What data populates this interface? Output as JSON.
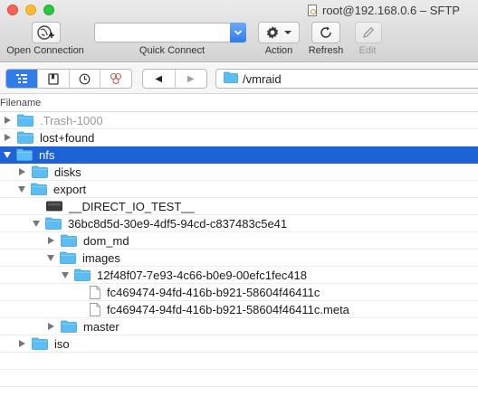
{
  "window": {
    "title": "root@192.168.0.6 – SFTP"
  },
  "toolbar": {
    "open_connection": "Open Connection",
    "quick_connect": "Quick Connect",
    "quick_connect_value": "",
    "action": "Action",
    "refresh": "Refresh",
    "edit": "Edit"
  },
  "nav": {
    "back": "◀",
    "forward": "▶",
    "path": "/vmraid"
  },
  "column": {
    "filename": "Filename"
  },
  "accent_color": "#1e63d6",
  "tree": [
    {
      "label": ".Trash-1000",
      "depth": 0,
      "kind": "folder",
      "disclosure": "collapsed",
      "dimmed": true
    },
    {
      "label": "lost+found",
      "depth": 0,
      "kind": "folder",
      "disclosure": "collapsed"
    },
    {
      "label": "nfs",
      "depth": 0,
      "kind": "folder",
      "disclosure": "expanded",
      "selected": true
    },
    {
      "label": "disks",
      "depth": 1,
      "kind": "folder",
      "disclosure": "collapsed"
    },
    {
      "label": "export",
      "depth": 1,
      "kind": "folder",
      "disclosure": "expanded"
    },
    {
      "label": "__DIRECT_IO_TEST__",
      "depth": 2,
      "kind": "device",
      "disclosure": "none"
    },
    {
      "label": "36bc8d5d-30e9-4df5-94cd-c837483c5e41",
      "depth": 2,
      "kind": "folder",
      "disclosure": "expanded"
    },
    {
      "label": "dom_md",
      "depth": 3,
      "kind": "folder",
      "disclosure": "collapsed"
    },
    {
      "label": "images",
      "depth": 3,
      "kind": "folder",
      "disclosure": "expanded"
    },
    {
      "label": "12f48f07-7e93-4c66-b0e9-00efc1fec418",
      "depth": 4,
      "kind": "folder",
      "disclosure": "expanded"
    },
    {
      "label": "fc469474-94fd-416b-b921-58604f46411c",
      "depth": 5,
      "kind": "file",
      "disclosure": "none"
    },
    {
      "label": "fc469474-94fd-416b-b921-58604f46411c.meta",
      "depth": 5,
      "kind": "file",
      "disclosure": "none"
    },
    {
      "label": "master",
      "depth": 3,
      "kind": "folder",
      "disclosure": "collapsed"
    },
    {
      "label": "iso",
      "depth": 1,
      "kind": "folder",
      "disclosure": "collapsed"
    }
  ]
}
